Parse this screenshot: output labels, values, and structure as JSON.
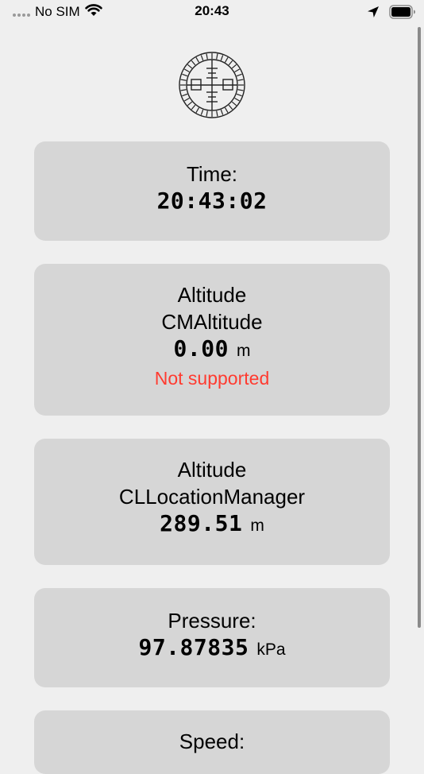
{
  "status_bar": {
    "carrier": "No SIM",
    "time": "20:43"
  },
  "cards": {
    "time": {
      "label": "Time:",
      "value": "20:43:02"
    },
    "cm_altitude": {
      "label": "Altitude",
      "sublabel": "CMAltitude",
      "value": "0.00",
      "unit": "m",
      "status": "Not supported",
      "status_color": "#ff3b30"
    },
    "cl_altitude": {
      "label": "Altitude",
      "sublabel": "CLLocationManager",
      "value": "289.51",
      "unit": "m"
    },
    "pressure": {
      "label": "Pressure:",
      "value": "97.87835",
      "unit": "kPa"
    },
    "speed": {
      "label": "Speed:"
    }
  },
  "colors": {
    "background": "#efefef",
    "card": "#d6d6d6",
    "error": "#ff3b30"
  },
  "icons": {
    "status_bar": [
      "signal-dots-icon",
      "wifi-icon",
      "location-arrow-icon",
      "battery-icon"
    ],
    "app": "compass-logo-icon"
  }
}
